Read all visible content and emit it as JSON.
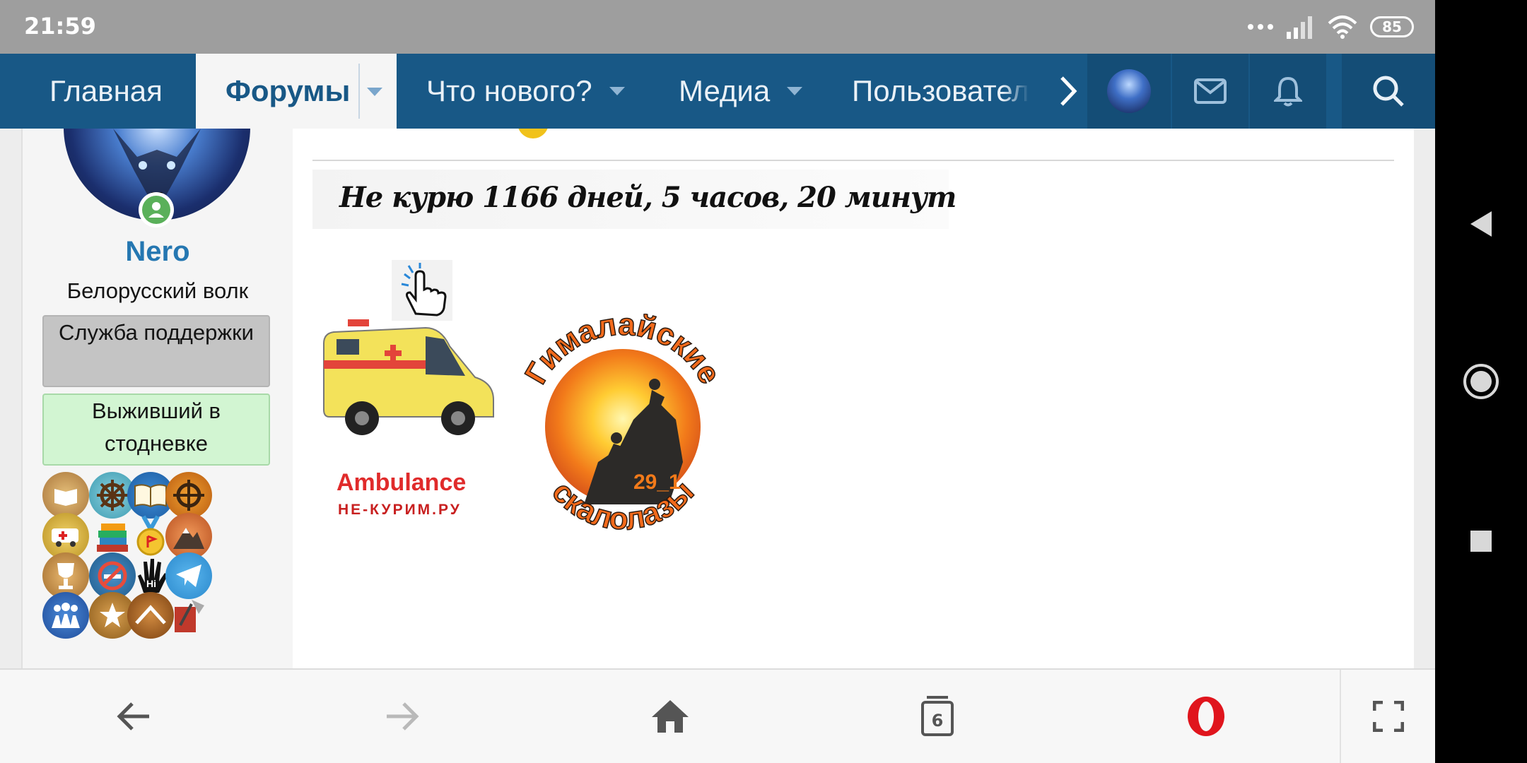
{
  "status_bar": {
    "time": "21:59",
    "battery": "85"
  },
  "nav": {
    "home": "Главная",
    "forums": "Форумы",
    "whats_new": "Что нового?",
    "media": "Медиа",
    "members": "Пользовател"
  },
  "sidebar": {
    "username": "Nero",
    "user_title": "Белорусский волк",
    "banners": [
      "Служба поддержки",
      "Выживший в стодневке"
    ]
  },
  "post": {
    "counter_text": "Не курю  1166 дней, 5 часов, 20 минут",
    "ambulance_label": "Ambulance",
    "ambulance_sub": "НЕ-КУРИМ.РУ",
    "climbers_top": "Гималайские",
    "climbers_bottom": "скалолазы",
    "climbers_num": "29_1"
  },
  "browser": {
    "tab_count": "6"
  },
  "colors": {
    "nav_bg": "#185886",
    "accent": "#2577b1",
    "opera_red": "#e0151d"
  }
}
